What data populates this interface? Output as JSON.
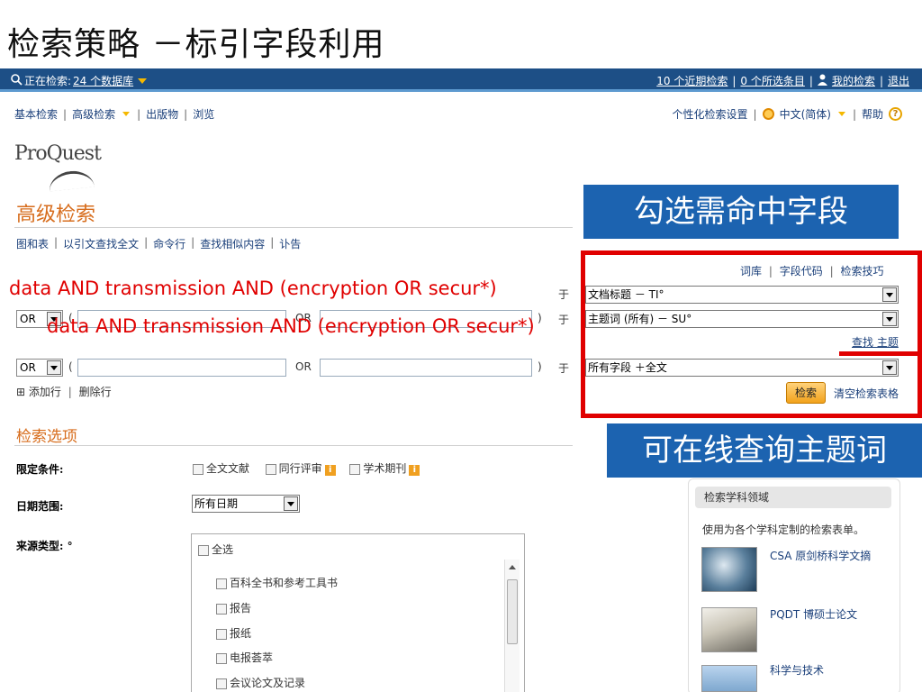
{
  "slide": {
    "title": "检索策略 －标引字段利用"
  },
  "topbar": {
    "searching_prefix": "正在检索:",
    "db_count": "24 个数据库",
    "recent_searches": "10 个近期检索",
    "selected_items": "0 个所选条目",
    "my_search": "我的检索",
    "logout": "退出",
    "separator": "|"
  },
  "nav": {
    "items": [
      "基本检索",
      "高级检索",
      "出版物",
      "浏览"
    ],
    "right": {
      "prefs": "个性化检索设置",
      "language": "中文(简体)",
      "help": "帮助"
    }
  },
  "logo": {
    "text": "ProQuest"
  },
  "advanced": {
    "title": "高级检索",
    "subnav": [
      "图和表",
      "以引文查找全文",
      "命令行",
      "查找相似内容",
      "讣告"
    ]
  },
  "overlay": {
    "query_line1": "data AND transmission AND (encryption OR secur*)",
    "query_line2": "data AND transmission AND (encryption OR secur*)"
  },
  "rows": [
    {
      "bool": "",
      "field": "文档标题 － TI°",
      "in_label": "于"
    },
    {
      "bool": "OR",
      "inner_bool": "OR",
      "field": "主题词 (所有) － SU°",
      "in_label": "于"
    },
    {
      "bool": "OR",
      "inner_bool": "OR",
      "field": "所有字段 ＋全文",
      "in_label": "于"
    }
  ],
  "row_tools": {
    "add_row": "添加行",
    "delete_row": "删除行"
  },
  "field_tools": {
    "thesaurus": "词库",
    "field_codes": "字段代码",
    "tips": "检索技巧",
    "find_subject": "查找 主题"
  },
  "actions": {
    "search": "检索",
    "clear_form": "清空检索表格"
  },
  "callouts": {
    "select_fields": "勾选需命中字段",
    "online_subjects": "可在线查询主题词"
  },
  "options": {
    "title": "检索选项",
    "limit_label": "限定条件:",
    "limits": [
      "全文文献",
      "同行评审",
      "学术期刊"
    ],
    "info_badge": "i",
    "date_label": "日期范围:",
    "date_value": "所有日期",
    "source_label": "来源类型: °",
    "source_select_all": "全选",
    "source_types": [
      "百科全书和参考工具书",
      "报告",
      "报纸",
      "电报荟萃",
      "会议论文及记录"
    ]
  },
  "side": {
    "header": "检索学科领域",
    "description": "使用为各个学科定制的检索表单。",
    "items": [
      {
        "label": "CSA 原剑桥科学文摘"
      },
      {
        "label": "PQDT 博硕士论文"
      },
      {
        "label": "科学与技术"
      }
    ]
  },
  "colors": {
    "topbar": "#1d4f86",
    "accent_orange": "#d76d1d",
    "callout_blue": "#1c63b0",
    "highlight_red": "#e00000"
  }
}
